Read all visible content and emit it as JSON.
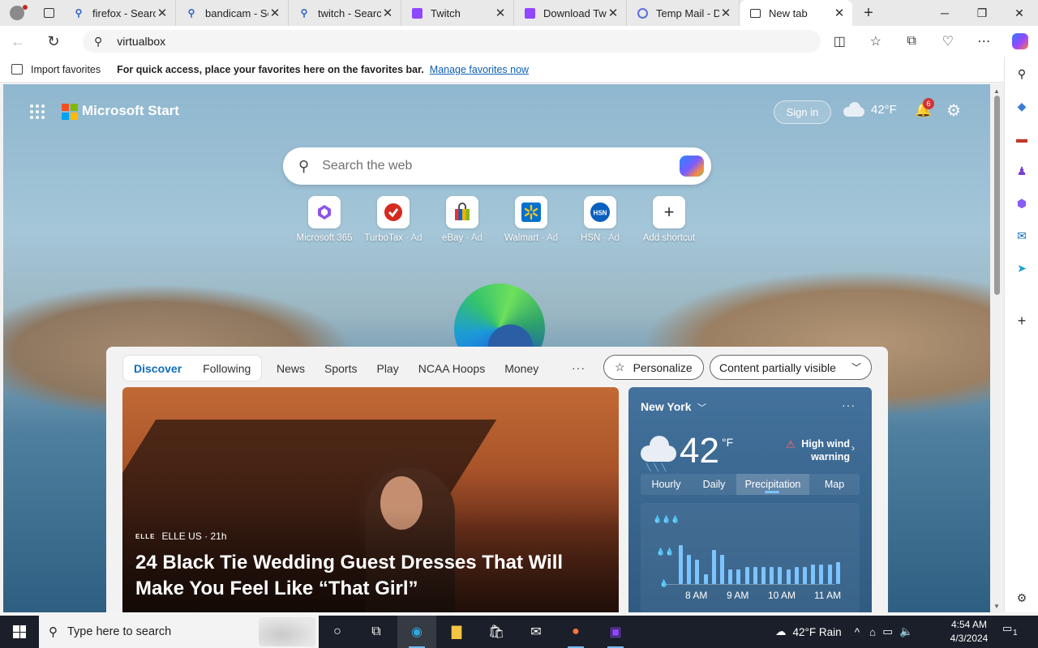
{
  "browser": {
    "tabs": [
      {
        "title": "firefox - Search",
        "icon": "search-icon",
        "close": "✕"
      },
      {
        "title": "bandicam - Search",
        "icon": "search-icon",
        "close": "✕"
      },
      {
        "title": "twitch - Search",
        "icon": "search-icon",
        "close": "✕"
      },
      {
        "title": "Twitch",
        "icon": "twitch-icon",
        "close": "✕"
      },
      {
        "title": "Download Twitch",
        "icon": "twitch-icon",
        "close": "✕"
      },
      {
        "title": "Temp Mail - Disposable",
        "icon": "tempmail-icon",
        "close": "✕"
      },
      {
        "title": "New tab",
        "icon": "newtab-icon",
        "close": "✕",
        "active": true
      }
    ],
    "address_value": "virtualbox"
  },
  "favorites_bar": {
    "import_label": "Import favorites",
    "hint": "For quick access, place your favorites here on the favorites bar.",
    "manage_link": "Manage favorites now"
  },
  "start_page": {
    "brand": "Microsoft Start",
    "sign_in": "Sign in",
    "header_temp": "42°F",
    "notification_count": "6",
    "search_placeholder": "Search the web",
    "shortcuts": [
      {
        "label": "Microsoft 365",
        "ad": ""
      },
      {
        "label": "TurboTax",
        "ad": "· Ad"
      },
      {
        "label": "eBay",
        "ad": "· Ad"
      },
      {
        "label": "Walmart",
        "ad": "· Ad"
      },
      {
        "label": "HSN",
        "ad": "· Ad"
      },
      {
        "label": "Add shortcut",
        "ad": ""
      }
    ],
    "shortcut_icons": {
      "hsn": "HSN"
    }
  },
  "feed": {
    "pivots_main": [
      "Discover",
      "Following"
    ],
    "pivots": [
      "News",
      "Sports",
      "Play",
      "NCAA Hoops",
      "Money"
    ],
    "more": "···",
    "personalize": "Personalize",
    "visibility": "Content partially visible",
    "hero": {
      "source_logo": "ELLE",
      "source": "ELLE US · 21h",
      "headline": "24 Black Tie Wedding Guest Dresses That Will Make You Feel Like “That Girl”"
    }
  },
  "weather": {
    "city": "New York",
    "temp": "42",
    "unit": "°F",
    "alert": "High wind warning",
    "tabs": [
      "Hourly",
      "Daily",
      "Precipitation",
      "Map"
    ],
    "selected_tab": "Precipitation",
    "time_ticks": [
      "8 AM",
      "9 AM",
      "10 AM",
      "11 AM"
    ],
    "legend": [
      "💧💧💧",
      "💧💧",
      "💧"
    ]
  },
  "chart_data": {
    "type": "bar",
    "title": "",
    "xlabel": "",
    "ylabel": "",
    "categories": [
      "8 AM",
      "9 AM",
      "10 AM",
      "11 AM"
    ],
    "series": [
      {
        "values": [
          0.8,
          0.6,
          0.5,
          0.2,
          0.7,
          0.6,
          0.3,
          0.3,
          0.35,
          0.35,
          0.35,
          0.35,
          0.35,
          0.3,
          0.35,
          0.35,
          0.4,
          0.4,
          0.4,
          0.45
        ]
      }
    ],
    "ylim": [
      0,
      1
    ],
    "grid": false
  },
  "taskbar": {
    "search_placeholder": "Type here to search",
    "weather": "42°F  Rain",
    "time": "4:54 AM",
    "date": "4/3/2024",
    "notifications": "1"
  },
  "colors": {
    "accent": "#0f6cbd",
    "weather_card": "#3a6790",
    "precip_bar": "#7cc4ff",
    "taskbar": "#1a1f29"
  }
}
